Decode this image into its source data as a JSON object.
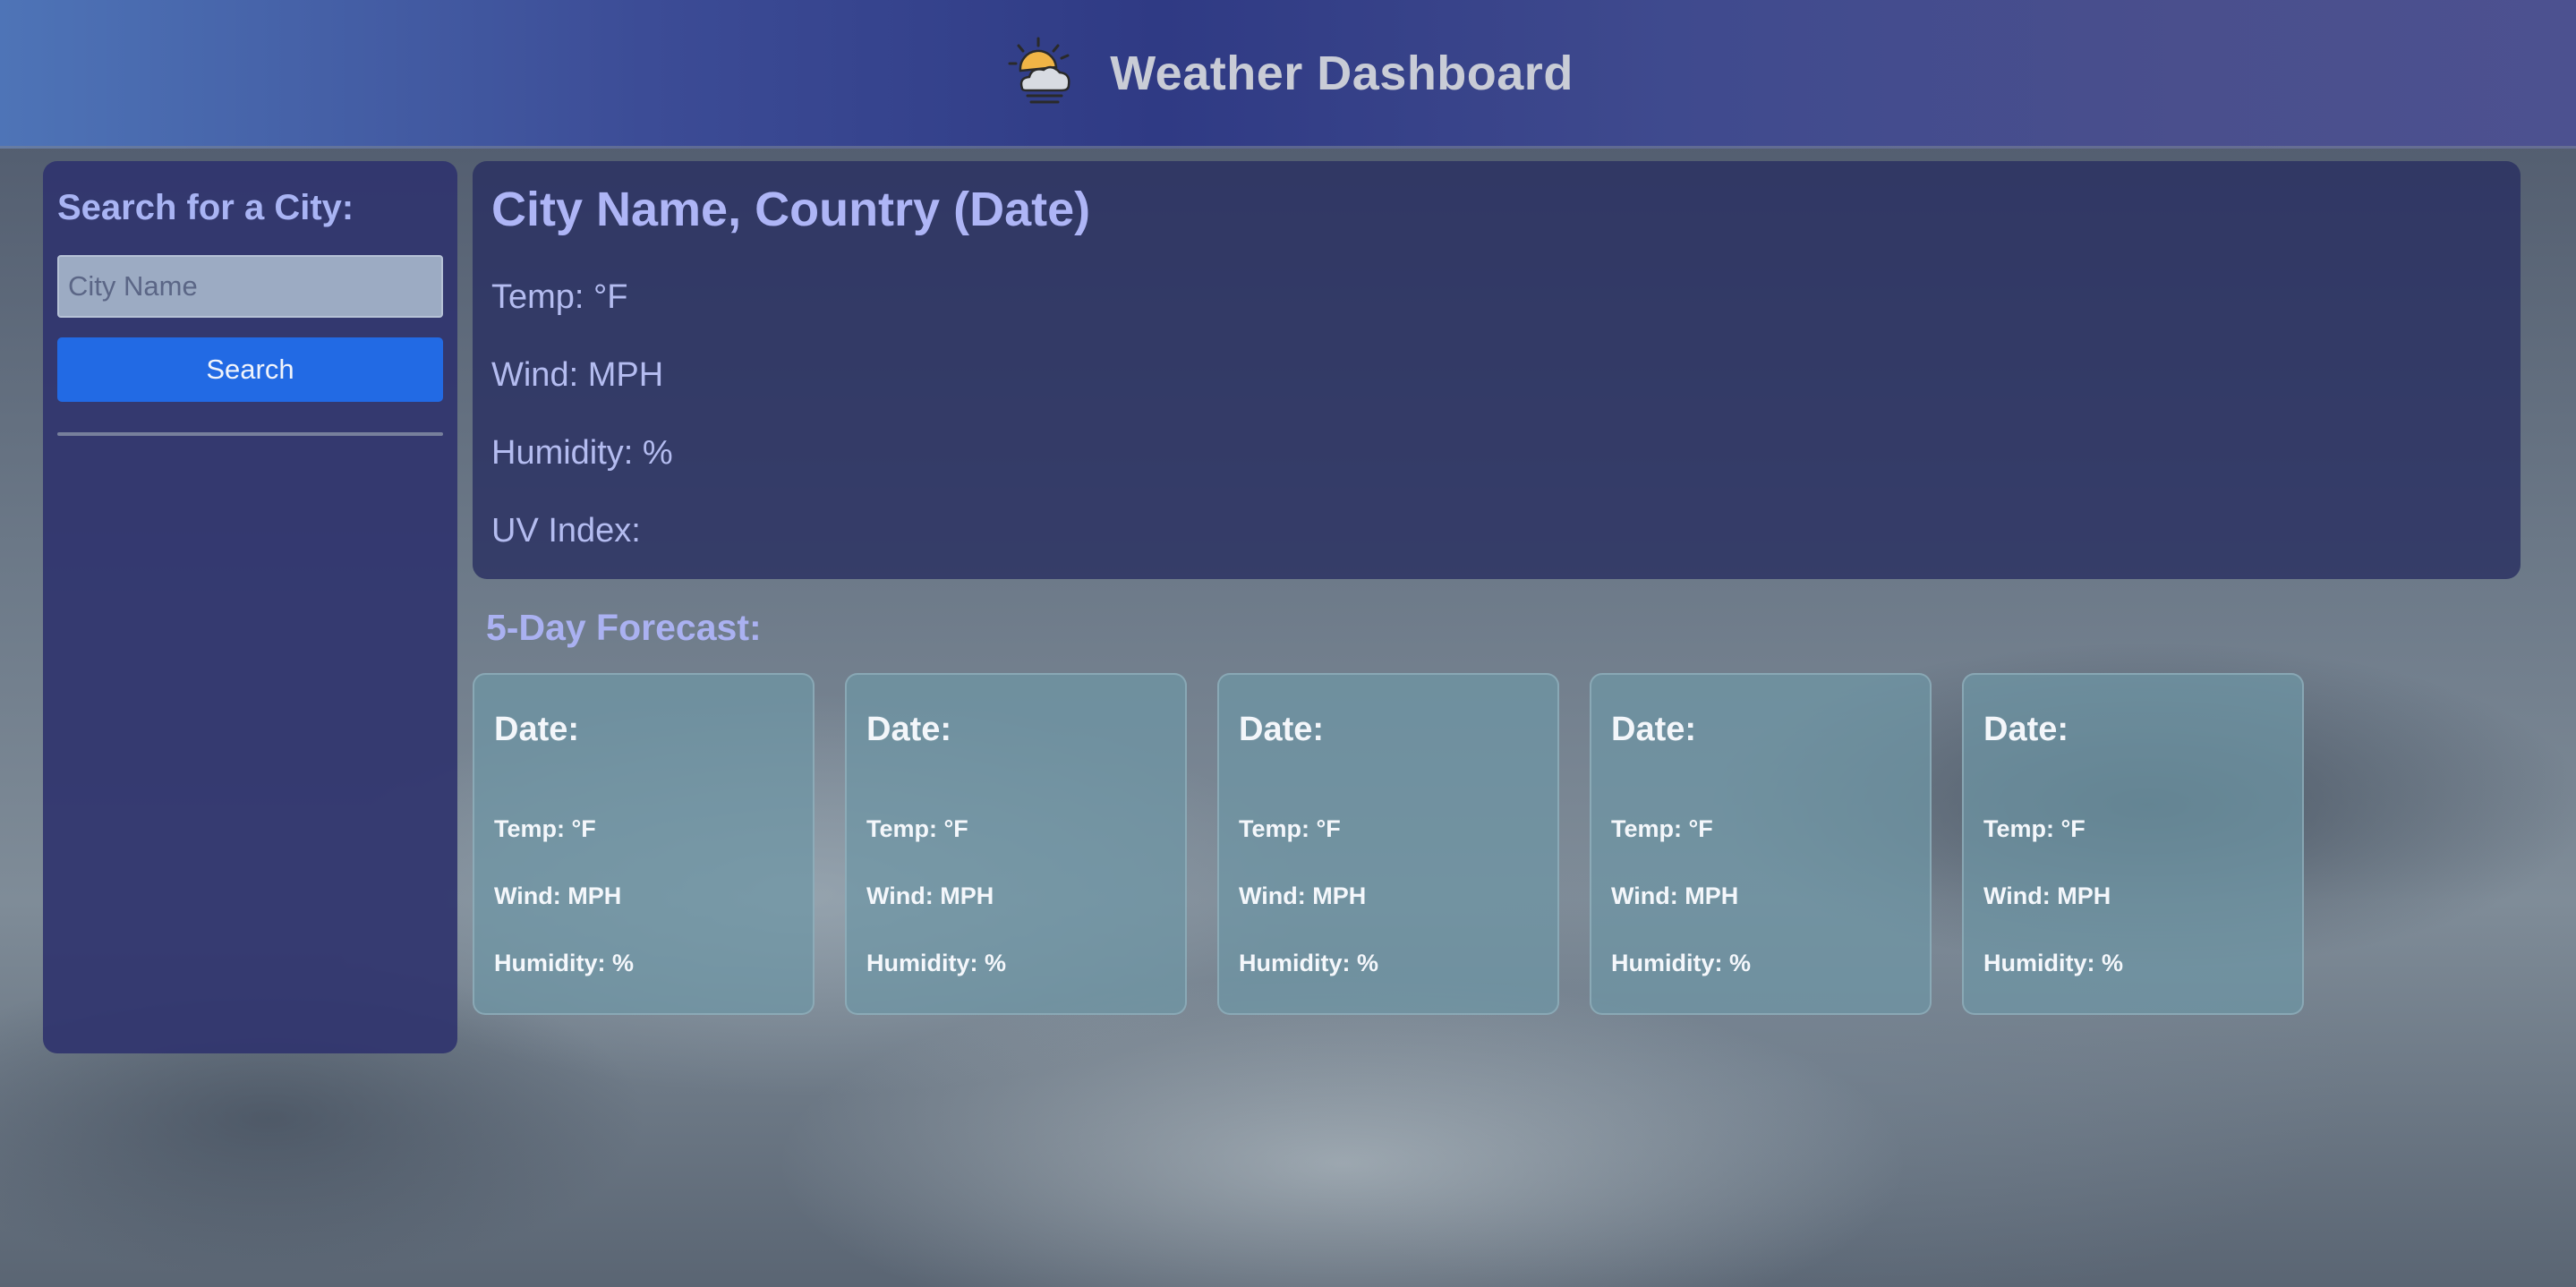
{
  "header": {
    "title": "Weather Dashboard",
    "icon": "sun-behind-cloud-icon"
  },
  "sidebar": {
    "heading": "Search for a City:",
    "input_placeholder": "City Name",
    "search_label": "Search"
  },
  "current": {
    "title": "City Name, Country (Date)",
    "temp": "Temp: °F",
    "wind": "Wind: MPH",
    "humidity": "Humidity: %",
    "uv": "UV Index:"
  },
  "forecast": {
    "heading": "5-Day Forecast:",
    "cards": [
      {
        "date": "Date:",
        "temp": "Temp: °F",
        "wind": "Wind: MPH",
        "humidity": "Humidity: %"
      },
      {
        "date": "Date:",
        "temp": "Temp: °F",
        "wind": "Wind: MPH",
        "humidity": "Humidity: %"
      },
      {
        "date": "Date:",
        "temp": "Temp: °F",
        "wind": "Wind: MPH",
        "humidity": "Humidity: %"
      },
      {
        "date": "Date:",
        "temp": "Temp: °F",
        "wind": "Wind: MPH",
        "humidity": "Humidity: %"
      },
      {
        "date": "Date:",
        "temp": "Temp: °F",
        "wind": "Wind: MPH",
        "humidity": "Humidity: %"
      }
    ]
  },
  "colors": {
    "header_gradient_start": "#4e74b7",
    "header_gradient_mid": "#2f3a84",
    "panel": "#30346e",
    "accent_text": "#a9b4f4",
    "search_button": "#226ae4",
    "card": "#6e96a5"
  }
}
